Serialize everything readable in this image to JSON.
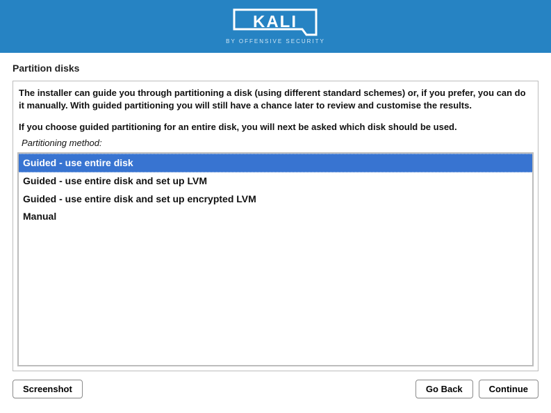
{
  "banner": {
    "logo_text": "KALI",
    "logo_sub": "BY OFFENSIVE SECURITY"
  },
  "title": "Partition disks",
  "instr1": "The installer can guide you through partitioning a disk (using different standard schemes) or, if you prefer, you can do it manually. With guided partitioning you will still have a chance later to review and customise the results.",
  "instr2": "If you choose guided partitioning for an entire disk, you will next be asked which disk should be used.",
  "method_label": "Partitioning method:",
  "options": [
    "Guided - use entire disk",
    "Guided - use entire disk and set up LVM",
    "Guided - use entire disk and set up encrypted LVM",
    "Manual"
  ],
  "selected_index": 0,
  "buttons": {
    "screenshot": "Screenshot",
    "go_back": "Go Back",
    "continue": "Continue"
  }
}
